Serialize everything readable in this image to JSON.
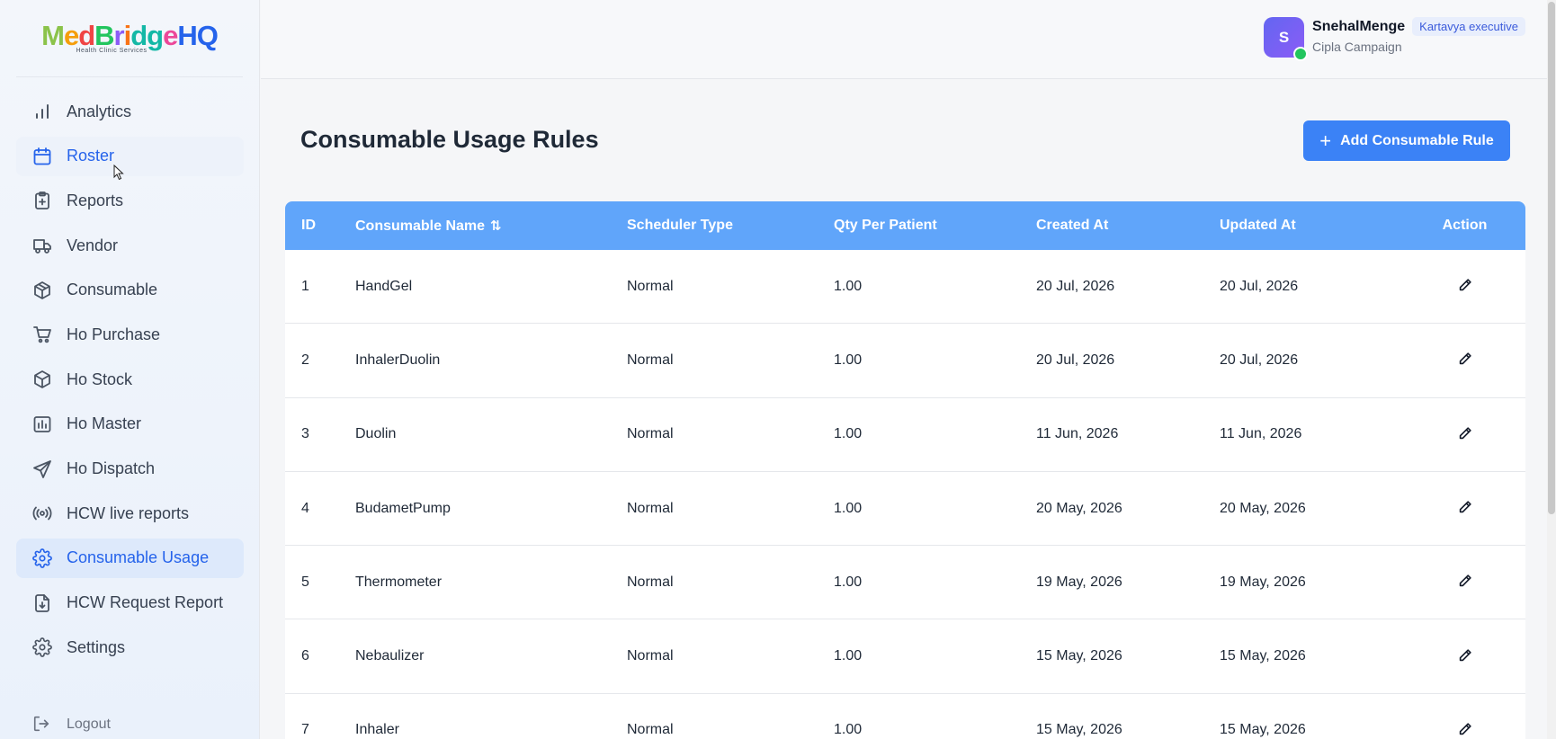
{
  "brand": {
    "logo_parts": [
      "M",
      "e",
      "d",
      "B",
      "r",
      "i",
      "dg",
      "e",
      "HQ"
    ],
    "logo_text": "MedBridgeHQ",
    "tagline": "Health Clinic Services"
  },
  "sidebar": {
    "items": [
      {
        "label": "Analytics",
        "icon": "bar-chart-icon"
      },
      {
        "label": "Roster",
        "icon": "calendar-icon"
      },
      {
        "label": "Reports",
        "icon": "clipboard-icon"
      },
      {
        "label": "Vendor",
        "icon": "truck-icon"
      },
      {
        "label": "Consumable",
        "icon": "package-icon"
      },
      {
        "label": "Ho Purchase",
        "icon": "shopping-cart-icon"
      },
      {
        "label": "Ho Stock",
        "icon": "box-icon"
      },
      {
        "label": "Ho Master",
        "icon": "folder-chart-icon"
      },
      {
        "label": "Ho Dispatch",
        "icon": "send-icon"
      },
      {
        "label": "HCW live reports",
        "icon": "broadcast-icon"
      },
      {
        "label": "Consumable Usage",
        "icon": "gear-icon"
      },
      {
        "label": "HCW Request Report",
        "icon": "file-download-icon"
      },
      {
        "label": "Settings",
        "icon": "gear-icon"
      }
    ],
    "logout_label": "Logout"
  },
  "header": {
    "user_initial": "S",
    "user_name": "SnehalMenge",
    "role": "Kartavya executive",
    "campaign": "Cipla Campaign"
  },
  "main": {
    "title": "Consumable Usage Rules",
    "add_button_label": "Add Consumable Rule",
    "add_button_icon": "plus-icon"
  },
  "table": {
    "columns": [
      "ID",
      "Consumable Name",
      "Scheduler Type",
      "Qty Per Patient",
      "Created At",
      "Updated At",
      "Action"
    ],
    "rows": [
      {
        "id": "1",
        "name": "HandGel",
        "type": "Normal",
        "qty": "1.00",
        "created": "20 Jul, 2026",
        "updated": "20 Jul, 2026"
      },
      {
        "id": "2",
        "name": "InhalerDuolin",
        "type": "Normal",
        "qty": "1.00",
        "created": "20 Jul, 2026",
        "updated": "20 Jul, 2026"
      },
      {
        "id": "3",
        "name": "Duolin",
        "type": "Normal",
        "qty": "1.00",
        "created": "11 Jun, 2026",
        "updated": "11 Jun, 2026"
      },
      {
        "id": "4",
        "name": "BudametPump",
        "type": "Normal",
        "qty": "1.00",
        "created": "20 May, 2026",
        "updated": "20 May, 2026"
      },
      {
        "id": "5",
        "name": "Thermometer",
        "type": "Normal",
        "qty": "1.00",
        "created": "19 May, 2026",
        "updated": "19 May, 2026"
      },
      {
        "id": "6",
        "name": "Nebaulizer",
        "type": "Normal",
        "qty": "1.00",
        "created": "15 May, 2026",
        "updated": "15 May, 2026"
      },
      {
        "id": "7",
        "name": "Inhaler",
        "type": "Normal",
        "qty": "1.00",
        "created": "15 May, 2026",
        "updated": "15 May, 2026"
      }
    ]
  },
  "colors": {
    "accent": "#3b82f6",
    "table_header": "#60a5fa",
    "active_nav": "#dde9fb",
    "online": "#22c55e"
  }
}
